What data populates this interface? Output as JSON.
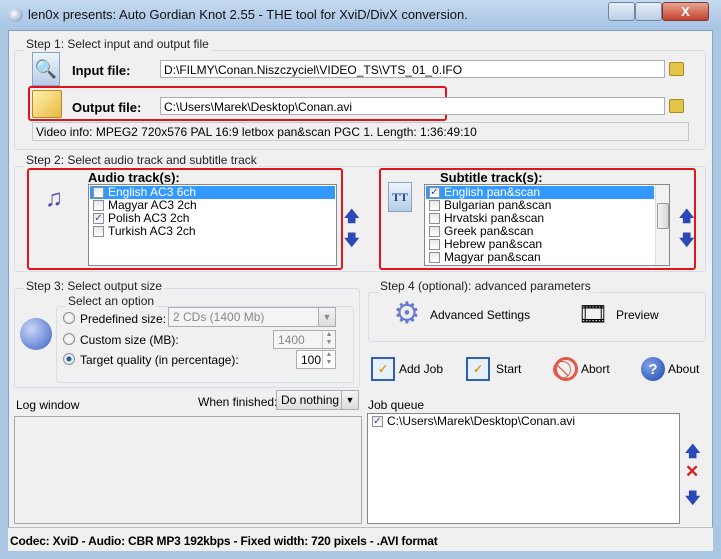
{
  "window": {
    "title": "len0x presents: Auto Gordian Knot 2.55 - THE tool for XviD/DivX conversion.",
    "close_glyph": "X"
  },
  "step1": {
    "legend": "Step 1: Select input and output file",
    "input_label": "Input file:",
    "input_value": "D:\\FILMY\\Conan.Niszczyciel\\VIDEO_TS\\VTS_01_0.IFO",
    "output_label": "Output file:",
    "output_value": "C:\\Users\\Marek\\Desktop\\Conan.avi",
    "video_info": "Video info: MPEG2 720x576 PAL 16:9 letbox pan&scan PGC 1. Length: 1:36:49:10"
  },
  "step2": {
    "legend": "Step 2: Select audio track and subtitle track",
    "audio_label": "Audio track(s):",
    "audio_tracks": [
      {
        "label": "English AC3 6ch",
        "checked": false,
        "selected": true
      },
      {
        "label": "Magyar AC3 2ch",
        "checked": false
      },
      {
        "label": "Polish AC3 2ch",
        "checked": true
      },
      {
        "label": "Turkish AC3 2ch",
        "checked": false
      }
    ],
    "subtitle_label": "Subtitle track(s):",
    "subtitle_tracks": [
      {
        "label": "English pan&scan",
        "checked": true,
        "selected": true
      },
      {
        "label": "Bulgarian pan&scan",
        "checked": false
      },
      {
        "label": "Hrvatski pan&scan",
        "checked": false
      },
      {
        "label": "Greek pan&scan",
        "checked": false
      },
      {
        "label": "Hebrew pan&scan",
        "checked": false
      },
      {
        "label": "Magyar pan&scan",
        "checked": false
      }
    ]
  },
  "step3": {
    "legend": "Step 3: Select output size",
    "option_legend": "Select an option",
    "predefined_label": "Predefined size:",
    "predefined_value": "2 CDs (1400 Mb)",
    "custom_label": "Custom size (MB):",
    "custom_value": "1400",
    "quality_label": "Target quality (in percentage):",
    "quality_value": "100",
    "selected_option": "Target quality"
  },
  "step4": {
    "legend": "Step 4 (optional): advanced parameters",
    "advanced_label": "Advanced Settings",
    "preview_label": "Preview"
  },
  "actions": {
    "add_job": "Add Job",
    "start": "Start",
    "abort": "Abort",
    "about": "About"
  },
  "log": {
    "label": "Log window",
    "when_finished_label": "When finished:",
    "when_finished_value": "Do nothing"
  },
  "queue": {
    "label": "Job queue",
    "items": [
      {
        "label": "C:\\Users\\Marek\\Desktop\\Conan.avi",
        "checked": true
      }
    ]
  },
  "status": "Codec: XviD -  Audio: CBR MP3 192kbps -  Fixed width: 720 pixels - .AVI format",
  "colors": {
    "highlight": "#e0141a",
    "selection": "#3399ff",
    "arrows": "#2c48b8"
  }
}
